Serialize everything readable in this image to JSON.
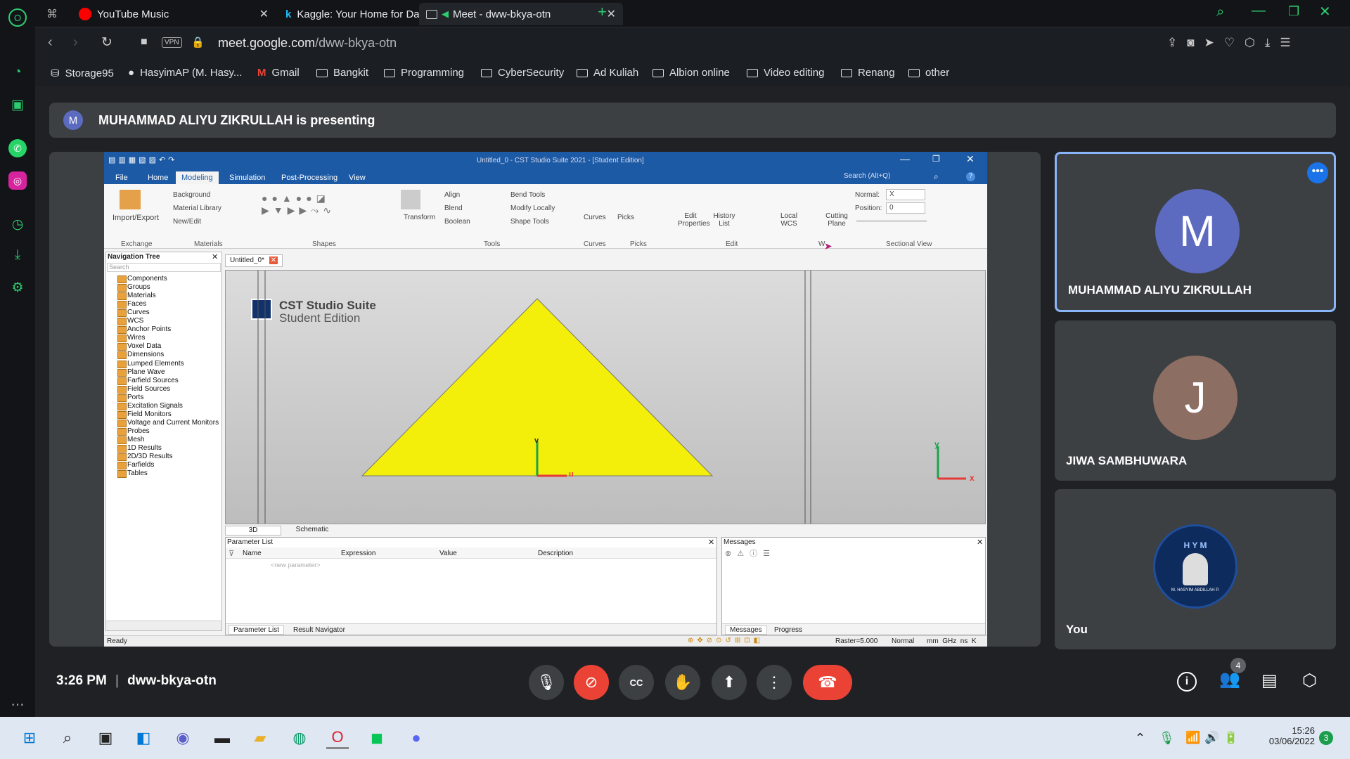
{
  "tabs": [
    {
      "label": "YouTube Music"
    },
    {
      "label": "Kaggle: Your Home for Dat"
    },
    {
      "label": "Meet - dww-bkya-otn"
    }
  ],
  "address": {
    "url_host": "meet.google.com",
    "url_path": "/dww-bkya-otn",
    "vpn": "VPN"
  },
  "bookmarks": [
    "Storage95",
    "HasyimAP (M. Hasy...",
    "Gmail",
    "Bangkit",
    "Programming",
    "CyberSecurity",
    "Ad Kuliah",
    "Albion online",
    "Video editing",
    "Renang",
    "other"
  ],
  "meet": {
    "banner_initial": "M",
    "banner_text": "MUHAMMAD ALIYU ZIKRULLAH is presenting",
    "time": "3:26 PM",
    "meeting_code": "dww-bkya-otn",
    "participants_count": "4",
    "tiles": [
      {
        "initial": "M",
        "name": "MUHAMMAD ALIYU ZIKRULLAH",
        "color": "#5c6bc0"
      },
      {
        "initial": "J",
        "name": "JIWA SAMBHUWARA",
        "color": "#8d6e63"
      },
      {
        "initial": "",
        "name": "You",
        "badge": "H Y M",
        "badge_sub": "M. HASYIM ABDILLAH P."
      }
    ]
  },
  "cst": {
    "title": "Untitled_0 - CST Studio Suite 2021 - [Student Edition]",
    "menus": [
      "File",
      "Home",
      "Modeling",
      "Simulation",
      "Post-Processing",
      "View"
    ],
    "search_placeholder": "Search (Alt+Q)",
    "ribbon": {
      "import_export": "Import/Export",
      "background": "Background",
      "material_library": "Material Library",
      "new_edit": "New/Edit",
      "align": "Align",
      "blend": "Blend",
      "boolean": "Boolean",
      "bend_tools": "Bend Tools",
      "modify_locally": "Modify Locally",
      "shape_tools": "Shape Tools",
      "transform": "Transform",
      "curves": "Curves",
      "picks": "Picks",
      "edit_properties": "Edit Properties",
      "history_list": "History List",
      "local_wcs": "Local WCS",
      "cutting_plane": "Cutting Plane",
      "normal_label": "Normal:",
      "normal_value": "X",
      "position_label": "Position:",
      "position_value": "0",
      "groups": [
        "Exchange",
        "Materials",
        "Shapes",
        "Tools",
        "Curves",
        "Picks",
        "Edit",
        "W",
        "Sectional View"
      ]
    },
    "nav_title": "Navigation Tree",
    "nav_search": "Search",
    "doc_tab": "Untitled_0*",
    "tree": [
      "Components",
      "Groups",
      "Materials",
      "Faces",
      "Curves",
      "WCS",
      "Anchor Points",
      "Wires",
      "Voxel Data",
      "Dimensions",
      "Lumped Elements",
      "Plane Wave",
      "Farfield Sources",
      "Field Sources",
      "Ports",
      "Excitation Signals",
      "Field Monitors",
      "Voltage and Current Monitors",
      "Probes",
      "Mesh",
      "1D Results",
      "2D/3D Results",
      "Farfields",
      "Tables"
    ],
    "brand": "CST Studio Suite",
    "brand_sub": "Student Edition",
    "axis_v": "v",
    "axis_u": "u",
    "axis_y": "y",
    "axis_x": "x",
    "view_tabs": [
      "3D",
      "Schematic"
    ],
    "param_title": "Parameter List",
    "param_cols": [
      "Name",
      "Expression",
      "Value",
      "Description"
    ],
    "new_param": "<new parameter>",
    "param_tabs": [
      "Parameter List",
      "Result Navigator"
    ],
    "msg_title": "Messages",
    "msg_tabs": [
      "Messages",
      "Progress"
    ],
    "status_ready": "Ready",
    "raster": "Raster=5.000",
    "normal_status": "Normal",
    "units": "mm  GHz  ns  K"
  },
  "taskbar": {
    "time": "15:26",
    "date": "03/06/2022",
    "badge": "3"
  }
}
